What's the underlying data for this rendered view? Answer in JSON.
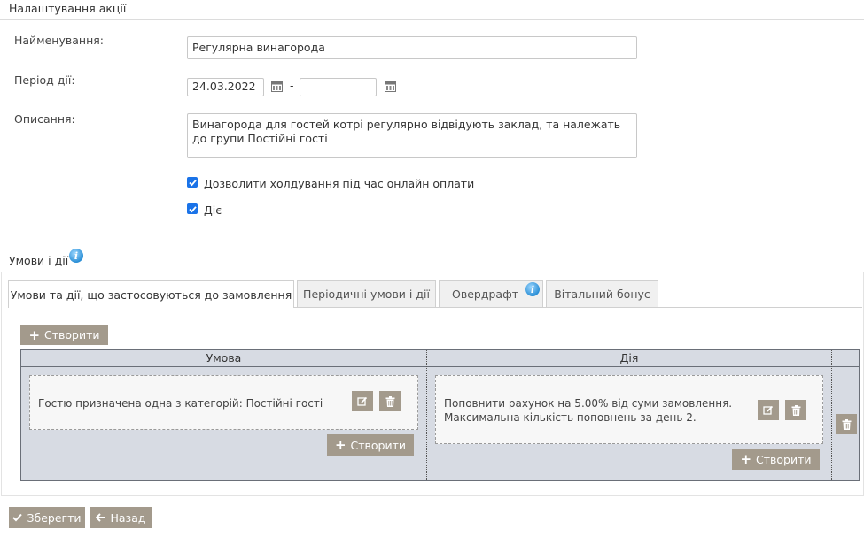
{
  "settings": {
    "title": "Налаштування акції",
    "name_label": "Найменування:",
    "name_value": "Регулярна винагорода",
    "period_label": "Період дії:",
    "period_start": "24.03.2022",
    "period_separator": "-",
    "period_end": "",
    "description_label": "Описання:",
    "description_value": "Винагорода для гостей котрі регулярно відвідують заклад, та належать до групи Постійні гості",
    "checkbox_hold_label": "Дозволити холдування під час онлайн оплати",
    "checkbox_hold_checked": true,
    "checkbox_active_label": "Діє",
    "checkbox_active_checked": true
  },
  "conditions": {
    "title": "Умови і дії",
    "tabs": [
      {
        "label": "Умови та дії, що застосовуються до замовлення",
        "active": true
      },
      {
        "label": "Періодичні умови і дії",
        "active": false
      },
      {
        "label": "Овердрафт",
        "active": false,
        "has_info": true
      },
      {
        "label": "Вітальний бонус",
        "active": false
      }
    ],
    "create_label": "Створити",
    "columns": [
      "Умова",
      "Дія"
    ],
    "rows": [
      {
        "condition": "Гостю призначена одна з категорій: Постійні гості",
        "action_line1": "Поповнити рахунок на 5.00% від суми замовлення.",
        "action_line2": "Максимальна кількість поповнень за день 2."
      }
    ]
  },
  "footer": {
    "save_label": "Зберегти",
    "back_label": "Назад"
  },
  "colors": {
    "button_bg": "#a39a8c",
    "grid_header": "#d7dbe3",
    "grid_body": "#d7dbe3",
    "checkbox": "#1a73e8",
    "info": "#2b8fd6"
  }
}
